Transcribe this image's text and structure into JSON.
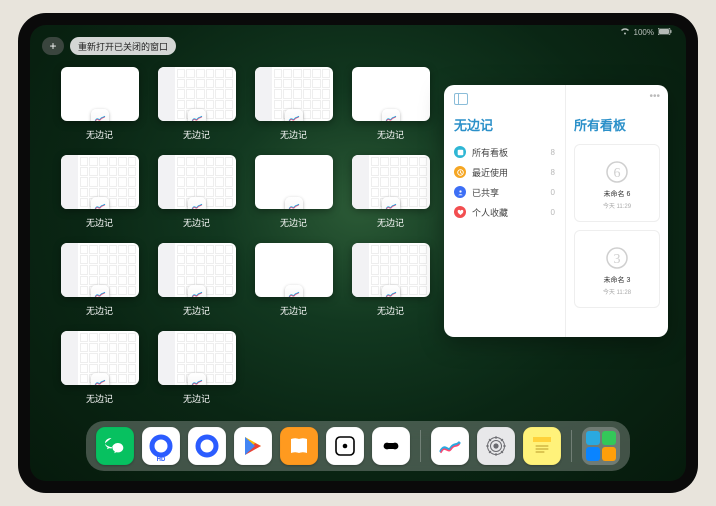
{
  "status": {
    "battery": "100%"
  },
  "topbar": {
    "add_label": "+",
    "restore_label": "重新打开已关闭的窗口"
  },
  "app_name": "无边记",
  "windows": [
    {
      "label": "无边记",
      "variant": "blank"
    },
    {
      "label": "无边记",
      "variant": "cal"
    },
    {
      "label": "无边记",
      "variant": "cal"
    },
    {
      "label": "无边记",
      "variant": "blank"
    },
    {
      "label": "无边记",
      "variant": "cal"
    },
    {
      "label": "无边记",
      "variant": "cal"
    },
    {
      "label": "无边记",
      "variant": "blank"
    },
    {
      "label": "无边记",
      "variant": "cal"
    },
    {
      "label": "无边记",
      "variant": "cal"
    },
    {
      "label": "无边记",
      "variant": "cal"
    },
    {
      "label": "无边记",
      "variant": "blank"
    },
    {
      "label": "无边记",
      "variant": "cal"
    },
    {
      "label": "无边记",
      "variant": "cal"
    },
    {
      "label": "无边记",
      "variant": "cal"
    }
  ],
  "window_rows": [
    4,
    4,
    4,
    2
  ],
  "panel": {
    "handle": "•••",
    "left_title": "无边记",
    "right_title": "所有看板",
    "categories": [
      {
        "label": "所有看板",
        "count": "8",
        "color": "#2fb6d4"
      },
      {
        "label": "最近使用",
        "count": "8",
        "color": "#f5a623"
      },
      {
        "label": "已共享",
        "count": "0",
        "color": "#3d6ff5"
      },
      {
        "label": "个人收藏",
        "count": "0",
        "color": "#f24e50"
      }
    ],
    "boards": [
      {
        "name": "未命名 6",
        "sub": "今天 11:29",
        "glyph": "6"
      },
      {
        "name": "未命名 3",
        "sub": "今天 11:28",
        "glyph": "3"
      }
    ]
  },
  "dock": {
    "apps": [
      {
        "name": "wechat",
        "bg": "#07c160"
      },
      {
        "name": "quark-hd",
        "bg": "#ffffff",
        "accent": "#2b5cff"
      },
      {
        "name": "quark",
        "bg": "#ffffff",
        "accent": "#2b5cff"
      },
      {
        "name": "play",
        "bg": "#ffffff"
      },
      {
        "name": "books",
        "bg": "#ff9a1f"
      },
      {
        "name": "dice",
        "bg": "#ffffff"
      },
      {
        "name": "keka",
        "bg": "#ffffff"
      },
      {
        "name": "freeform",
        "bg": "#ffffff"
      },
      {
        "name": "settings",
        "bg": "#e8e8ea"
      },
      {
        "name": "notes",
        "bg": "#fff27a"
      }
    ],
    "folder_colors": [
      "#2aa9e0",
      "#34c759",
      "#0a84ff",
      "#ff9f0a"
    ]
  }
}
